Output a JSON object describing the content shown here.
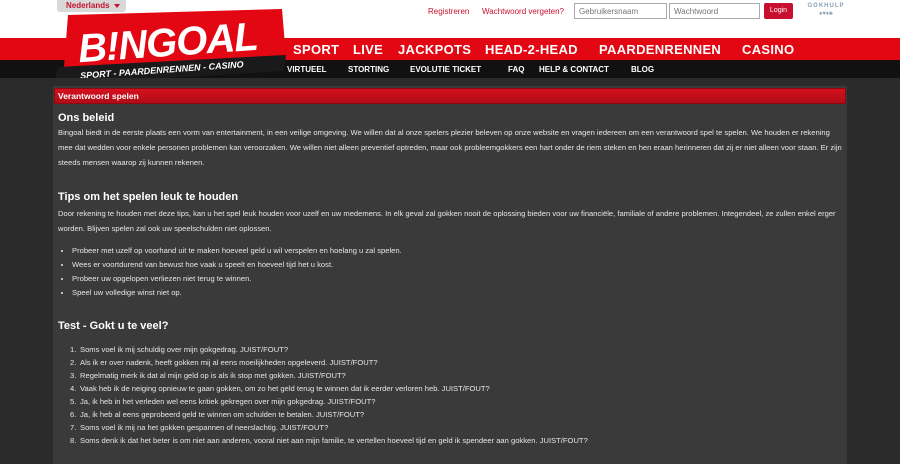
{
  "topbar": {
    "language": "Nederlands",
    "register_link": "Registreren",
    "forgot_password_link": "Wachtwoord vergeten?",
    "username_placeholder": "Gebruikersnaam",
    "password_placeholder": "Wachtwoord",
    "login_button": "Login",
    "gokhulp_label": "GOKHULP",
    "gokhulp_symbols": "♠♥♦♣"
  },
  "logo": {
    "brand": "B!NGOAL",
    "tagline": "SPORT - PAARDENRENNEN - CASINO"
  },
  "main_nav": [
    "SPORT",
    "LIVE",
    "JACKPOTS",
    "HEAD-2-HEAD",
    "PAARDENRENNEN",
    "CASINO"
  ],
  "sub_nav": [
    "VIRTUEEL",
    "STORTING",
    "EVOLUTIE TICKET",
    "FAQ",
    "HELP & CONTACT",
    "BLOG"
  ],
  "panel": {
    "title": "Verantwoord spelen",
    "sections": [
      {
        "heading": "Ons beleid",
        "paragraph": "Bingoal biedt in de eerste plaats een vorm van entertainment, in een veilige omgeving. We willen dat al onze spelers plezier beleven op onze website en vragen iedereen om een verantwoord spel te spelen. We houden er rekening mee dat wedden voor enkele personen problemen kan veroorzaken. We willen niet alleen preventief optreden, maar ook probleemgokkers een hart onder de riem steken en hen eraan herinneren dat zij er niet alleen voor staan. Er zijn steeds mensen waarop zij kunnen rekenen."
      },
      {
        "heading": "Tips om het spelen leuk te houden",
        "paragraph": "Door rekening te houden met deze tips, kan u het spel leuk houden voor uzelf en uw medemens. In elk geval zal gokken nooit de oplossing bieden voor uw financiële, familiale of andere problemen. Integendeel, ze zullen enkel erger worden. Blijven spelen zal ook uw speelschulden niet oplossen.",
        "bullets": [
          "Probeer met uzelf op voorhand uit te maken hoeveel geld u wil verspelen en hoelang u zal spelen.",
          "Wees er voortdurend van bewust hoe vaak u speelt en hoeveel tijd het u kost.",
          "Probeer uw opgelopen verliezen niet terug te winnen.",
          "Speel uw volledige winst niet op."
        ]
      },
      {
        "heading": "Test - Gokt u te veel?",
        "questions": [
          "Soms voel ik mij schuldig over mijn gokgedrag. JUIST/FOUT?",
          "Als ik er over nadenk, heeft gokken mij al eens moeilijkheden opgeleverd. JUIST/FOUT?",
          "Regelmatig merk ik dat al mijn geld op is als ik stop met gokken. JUIST/FOUT?",
          "Vaak heb ik de neiging opnieuw te gaan gokken, om zo het geld terug te winnen dat ik eerder verloren heb. JUIST/FOUT?",
          "Ja, ik heb in het verleden wel eens kritiek gekregen over mijn gokgedrag. JUIST/FOUT?",
          "Ja, ik heb al eens geprobeerd geld te winnen om schulden te betalen. JUIST/FOUT?",
          "Soms voel ik mij na het gokken gespannen of neerslachtig. JUIST/FOUT?",
          "Soms denk ik dat het beter is om niet aan anderen, vooral niet aan mijn familie, te vertellen hoeveel tijd en geld ik spendeer aan gokken. JUIST/FOUT?"
        ]
      }
    ]
  },
  "colors": {
    "brand_red": "#e30613",
    "background": "#2b2b2b",
    "panel": "#3a3a3a"
  }
}
